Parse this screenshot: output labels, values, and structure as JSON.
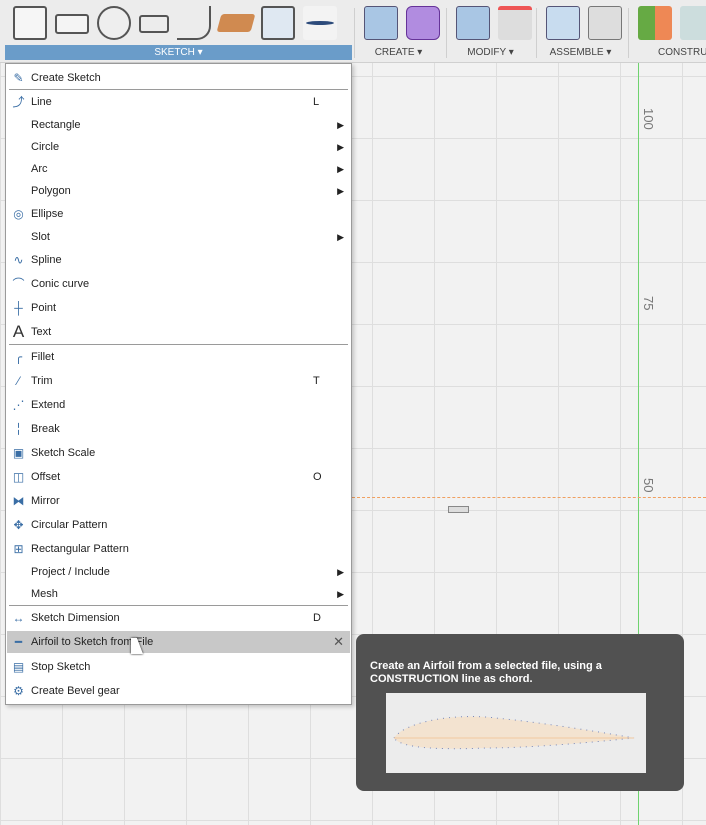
{
  "toolbar": {
    "groups": [
      {
        "label": "SKETCH ▾"
      },
      {
        "label": "CREATE ▾"
      },
      {
        "label": "MODIFY ▾"
      },
      {
        "label": "ASSEMBLE ▾"
      },
      {
        "label": "CONSTRU"
      }
    ]
  },
  "menu": {
    "items": [
      {
        "label": "Create Sketch",
        "icon": "create-sketch-icon"
      },
      {
        "label": "Line",
        "shortcut": "L",
        "icon": "line-icon"
      },
      {
        "label": "Rectangle",
        "submenu": true
      },
      {
        "label": "Circle",
        "submenu": true
      },
      {
        "label": "Arc",
        "submenu": true
      },
      {
        "label": "Polygon",
        "submenu": true
      },
      {
        "label": "Ellipse",
        "icon": "ellipse-icon"
      },
      {
        "label": "Slot",
        "submenu": true
      },
      {
        "label": "Spline",
        "icon": "spline-icon"
      },
      {
        "label": "Conic curve",
        "icon": "conic-curve-icon"
      },
      {
        "label": "Point",
        "icon": "point-icon"
      },
      {
        "label": "Text",
        "icon": "text-icon"
      },
      {
        "label": "Fillet",
        "icon": "fillet-icon"
      },
      {
        "label": "Trim",
        "shortcut": "T",
        "icon": "trim-icon"
      },
      {
        "label": "Extend",
        "icon": "extend-icon"
      },
      {
        "label": "Break",
        "icon": "break-icon"
      },
      {
        "label": "Sketch Scale",
        "icon": "sketch-scale-icon"
      },
      {
        "label": "Offset",
        "shortcut": "O",
        "icon": "offset-icon"
      },
      {
        "label": "Mirror",
        "icon": "mirror-icon"
      },
      {
        "label": "Circular Pattern",
        "icon": "circular-pattern-icon"
      },
      {
        "label": "Rectangular Pattern",
        "icon": "rectangular-pattern-icon"
      },
      {
        "label": "Project / Include",
        "submenu": true
      },
      {
        "label": "Mesh",
        "submenu": true
      },
      {
        "label": "Sketch Dimension",
        "shortcut": "D",
        "icon": "sketch-dimension-icon"
      },
      {
        "label": "Airfoil to Sketch from File",
        "icon": "airfoil-icon",
        "highlighted": true
      },
      {
        "label": "Stop Sketch",
        "icon": "stop-sketch-icon"
      },
      {
        "label": "Create Bevel gear",
        "icon": "bevel-gear-icon"
      }
    ]
  },
  "tooltip": {
    "text": "Create an Airfoil from a selected file, using a CONSTRUCTION line as chord."
  },
  "canvas": {
    "ruler": [
      "100",
      "75",
      "50"
    ]
  },
  "colors": {
    "accent": "#6a9cc9",
    "highlight": "#c8c8c8",
    "tooltip_bg": "#515151",
    "axis_green": "#6fd36f",
    "construction": "#f0a060"
  }
}
